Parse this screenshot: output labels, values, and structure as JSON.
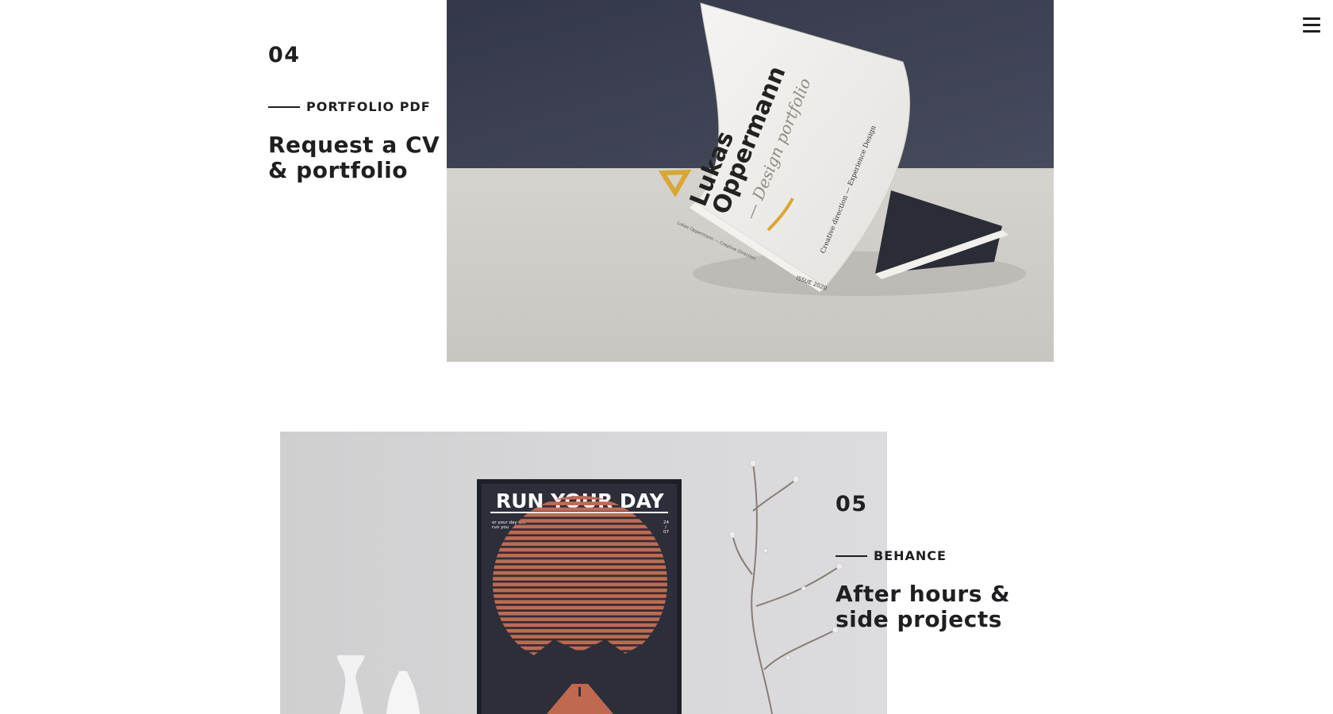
{
  "nav": {
    "menu_icon": "hamburger-menu-icon"
  },
  "projects": [
    {
      "number": "04",
      "tag": "PORTFOLIO PDF",
      "title": "Request a CV & portfolio",
      "image": {
        "subject": "magazine-mockup",
        "cover_name_line1": "Lukas",
        "cover_name_line2": "Oppermann",
        "cover_subtitle": "— Design portfolio",
        "cover_side_note": "Creative direction — Experience Design",
        "cover_issue": "ISSUE 2020",
        "spine_text": "Lukas Oppermann — Creative Direction"
      }
    },
    {
      "number": "05",
      "tag": "BEHANCE",
      "title": "After hours & side projects",
      "image": {
        "subject": "poster-mockup",
        "poster_title": "RUN YOUR DAY",
        "poster_subtitle_line1": "or your day will",
        "poster_subtitle_line2": "run you",
        "poster_date_day": "24",
        "poster_date_sep": "/",
        "poster_date_month": "07"
      }
    }
  ],
  "colors": {
    "text": "#1f1f22",
    "dark_wall": "#3d4151",
    "floor": "#dedcd8",
    "accent_gold": "#d9a732",
    "poster_bg": "#2c2f3a",
    "poster_sun": "#c1694f"
  }
}
